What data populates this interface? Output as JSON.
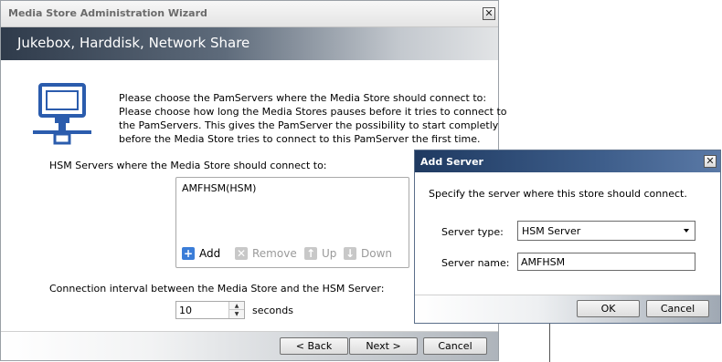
{
  "wizard": {
    "title": "Media Store Administration Wizard",
    "banner": "Jukebox, Harddisk, Network Share",
    "intro_lines": [
      "Please choose the PamServers where the Media Store should connect to:",
      "Please choose how long the Media Stores pauses before it tries to connect to",
      "the PamServers. This gives the PamServer the possibility to start completly",
      "before the Media Store tries to connect to this PamServer the first time."
    ],
    "servers_label": "HSM Servers where the Media Store should connect to:",
    "servers": [
      "AMFHSM(HSM)"
    ],
    "list_buttons": {
      "add": "Add",
      "remove": "Remove",
      "up": "Up",
      "down": "Down"
    },
    "interval_label": "Connection interval between the Media Store and the HSM Server:",
    "interval_value": "10",
    "interval_unit": "seconds",
    "buttons": {
      "back": "< Back",
      "next": "Next >",
      "cancel": "Cancel"
    }
  },
  "dialog": {
    "title": "Add Server",
    "prompt": "Specify the server where this store should connect.",
    "server_type_label": "Server type:",
    "server_type_value": "HSM Server",
    "server_name_label": "Server name:",
    "server_name_value": "AMFHSM",
    "buttons": {
      "ok": "OK",
      "cancel": "Cancel"
    }
  },
  "colors": {
    "accent_blue": "#3b7dd8",
    "icon_blue": "#2b5cad",
    "dialog_title": "#1f3a61"
  },
  "icons": [
    "close-icon",
    "computer-network-icon",
    "add-icon",
    "remove-icon",
    "up-arrow-icon",
    "down-arrow-icon",
    "dropdown-arrow-icon"
  ]
}
